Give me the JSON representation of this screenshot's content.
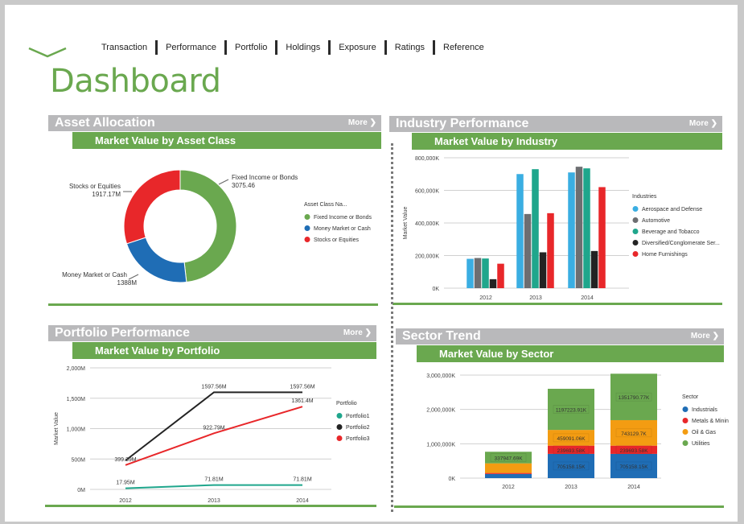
{
  "nav": [
    "Transaction",
    "Performance",
    "Portfolio",
    "Holdings",
    "Exposure",
    "Ratings",
    "Reference"
  ],
  "page_title": "Dashboard",
  "more_label": "More",
  "panels": {
    "asset": {
      "title": "Asset Allocation",
      "subtitle": "Market Value by Asset Class"
    },
    "industry": {
      "title": "Industry Performance",
      "subtitle": "Market Value by Industry"
    },
    "portfolio": {
      "title": "Portfolio Performance",
      "subtitle": "Market Value by Portfolio"
    },
    "sector": {
      "title": "Sector Trend",
      "subtitle": "Market Value by Sector"
    }
  },
  "colors": {
    "accent": "#6aa84f",
    "header_gray": "#b9b9bb"
  },
  "chart_data": [
    {
      "type": "pie",
      "donut": true,
      "slices": [
        {
          "label": "Fixed Income or Bonds",
          "value": 3075.46,
          "display": "3075.46",
          "color": "#6aa84f"
        },
        {
          "label": "Money Market or Cash",
          "value": 1388,
          "display": "1388M",
          "color": "#1f6db5"
        },
        {
          "label": "Stocks or Equities",
          "value": 1917.17,
          "display": "1917.17M",
          "color": "#e8272a"
        }
      ],
      "legend_title": "Asset Class Na...",
      "legend_position": "right"
    },
    {
      "type": "bar",
      "categories": [
        "2012",
        "2013",
        "2014"
      ],
      "series": [
        {
          "name": "Aerospace and Defense",
          "color": "#3aaee2",
          "values": [
            180000,
            700000,
            710000
          ]
        },
        {
          "name": "Automotive",
          "color": "#6d6e71",
          "values": [
            185000,
            455000,
            745000
          ]
        },
        {
          "name": "Beverage and Tobacco",
          "color": "#1fa68c",
          "values": [
            182000,
            730000,
            735000
          ]
        },
        {
          "name": "Diversified/Conglomerate Ser...",
          "color": "#232323",
          "values": [
            55000,
            220000,
            228000
          ]
        },
        {
          "name": "Home Furnishings",
          "color": "#e8272a",
          "values": [
            150000,
            460000,
            620000
          ]
        }
      ],
      "yticks": [
        "800,000K",
        "600,000K",
        "400,000K",
        "200,000K",
        "0K"
      ],
      "ylim": [
        0,
        800000
      ],
      "ylabel": "Market Value",
      "legend_title": "Industries",
      "legend_position": "right",
      "grid": true
    },
    {
      "type": "line",
      "x": [
        "2012",
        "2013",
        "2014"
      ],
      "series": [
        {
          "name": "Portfolio1",
          "color": "#1fa68c",
          "values": [
            17.95,
            71.81,
            71.81
          ],
          "labels": [
            "17.95M",
            "71.81M",
            "71.81M"
          ]
        },
        {
          "name": "Portfolio2",
          "color": "#232323",
          "values": [
            475,
            1597.56,
            1597.56
          ],
          "labels": [
            "",
            "1597.56M",
            "1597.56M"
          ]
        },
        {
          "name": "Portfolio3",
          "color": "#e8272a",
          "values": [
            399.39,
            922.79,
            1361.4
          ],
          "labels": [
            "399.39M",
            "922.79M",
            "1361.4M"
          ]
        }
      ],
      "yticks": [
        "2,000M",
        "1,500M",
        "1,000M",
        "500M",
        "0M"
      ],
      "ylim": [
        0,
        2000
      ],
      "ylabel": "Market Value",
      "legend_title": "Portfolio",
      "legend_position": "right",
      "grid": true
    },
    {
      "type": "bar",
      "stacked": true,
      "categories": [
        "2012",
        "2013",
        "2014"
      ],
      "series": [
        {
          "name": "Industrials",
          "color": "#1f6db5",
          "values": [
            120000,
            705158.15,
            705158.15
          ],
          "labels": [
            "",
            "705158.15K",
            "705158.15K"
          ]
        },
        {
          "name": "Metals & Mining",
          "color": "#e8272a",
          "values": [
            30000,
            239693.58,
            239693.58
          ],
          "labels": [
            "",
            "239693.58K",
            "239693.58K"
          ]
        },
        {
          "name": "Oil & Gas",
          "color": "#f39c12",
          "values": [
            280000,
            459091.06,
            743129.7
          ],
          "labels": [
            "",
            "459091.06K",
            "743129.7K"
          ]
        },
        {
          "name": "Utilities",
          "color": "#6aa84f",
          "values": [
            337947.69,
            1197223.91,
            1351790.77
          ],
          "labels": [
            "337947.69K",
            "1197223.91K",
            "1351790.77K"
          ]
        }
      ],
      "yticks": [
        "3,000,000K",
        "2,000,000K",
        "1,000,000K",
        "0K"
      ],
      "ylim": [
        0,
        3000000
      ],
      "legend_title": "Sector",
      "legend_position": "right",
      "grid": true
    }
  ]
}
